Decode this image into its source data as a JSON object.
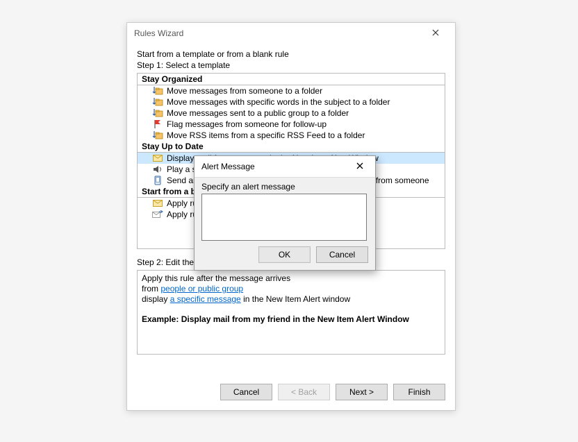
{
  "window": {
    "title": "Rules Wizard",
    "header": "Start from a template or from a blank rule",
    "step1": "Step 1: Select a template",
    "step2": "Step 2: Edit the rule description (click an underlined value)",
    "buttons": {
      "cancel": "Cancel",
      "back": "< Back",
      "next": "Next >",
      "finish": "Finish"
    }
  },
  "templates": {
    "cat1": "Stay Organized",
    "items1": [
      "Move messages from someone to a folder",
      "Move messages with specific words in the subject to a folder",
      "Move messages sent to a public group to a folder",
      "Flag messages from someone for follow-up",
      "Move RSS items from a specific RSS Feed to a folder"
    ],
    "cat2": "Stay Up to Date",
    "items2": [
      "Display mail from someone in the New Item Alert Window",
      "Play a sound when I get messages from someone",
      "Send an alert to my mobile device when I get messages from someone"
    ],
    "cat3": "Start from a blank rule",
    "items3": [
      "Apply rule on messages I receive",
      "Apply rule on messages I send"
    ]
  },
  "description": {
    "line1": "Apply this rule after the message arrives",
    "line2a": "from ",
    "link1": "people or public group",
    "line3a": "display ",
    "link2": "a specific message",
    "line3b": " in the New Item Alert window",
    "example": "Example: Display mail from my friend in the New Item Alert Window"
  },
  "modal": {
    "title": "Alert Message",
    "prompt": "Specify an alert message",
    "value": "",
    "ok": "OK",
    "cancel": "Cancel"
  }
}
